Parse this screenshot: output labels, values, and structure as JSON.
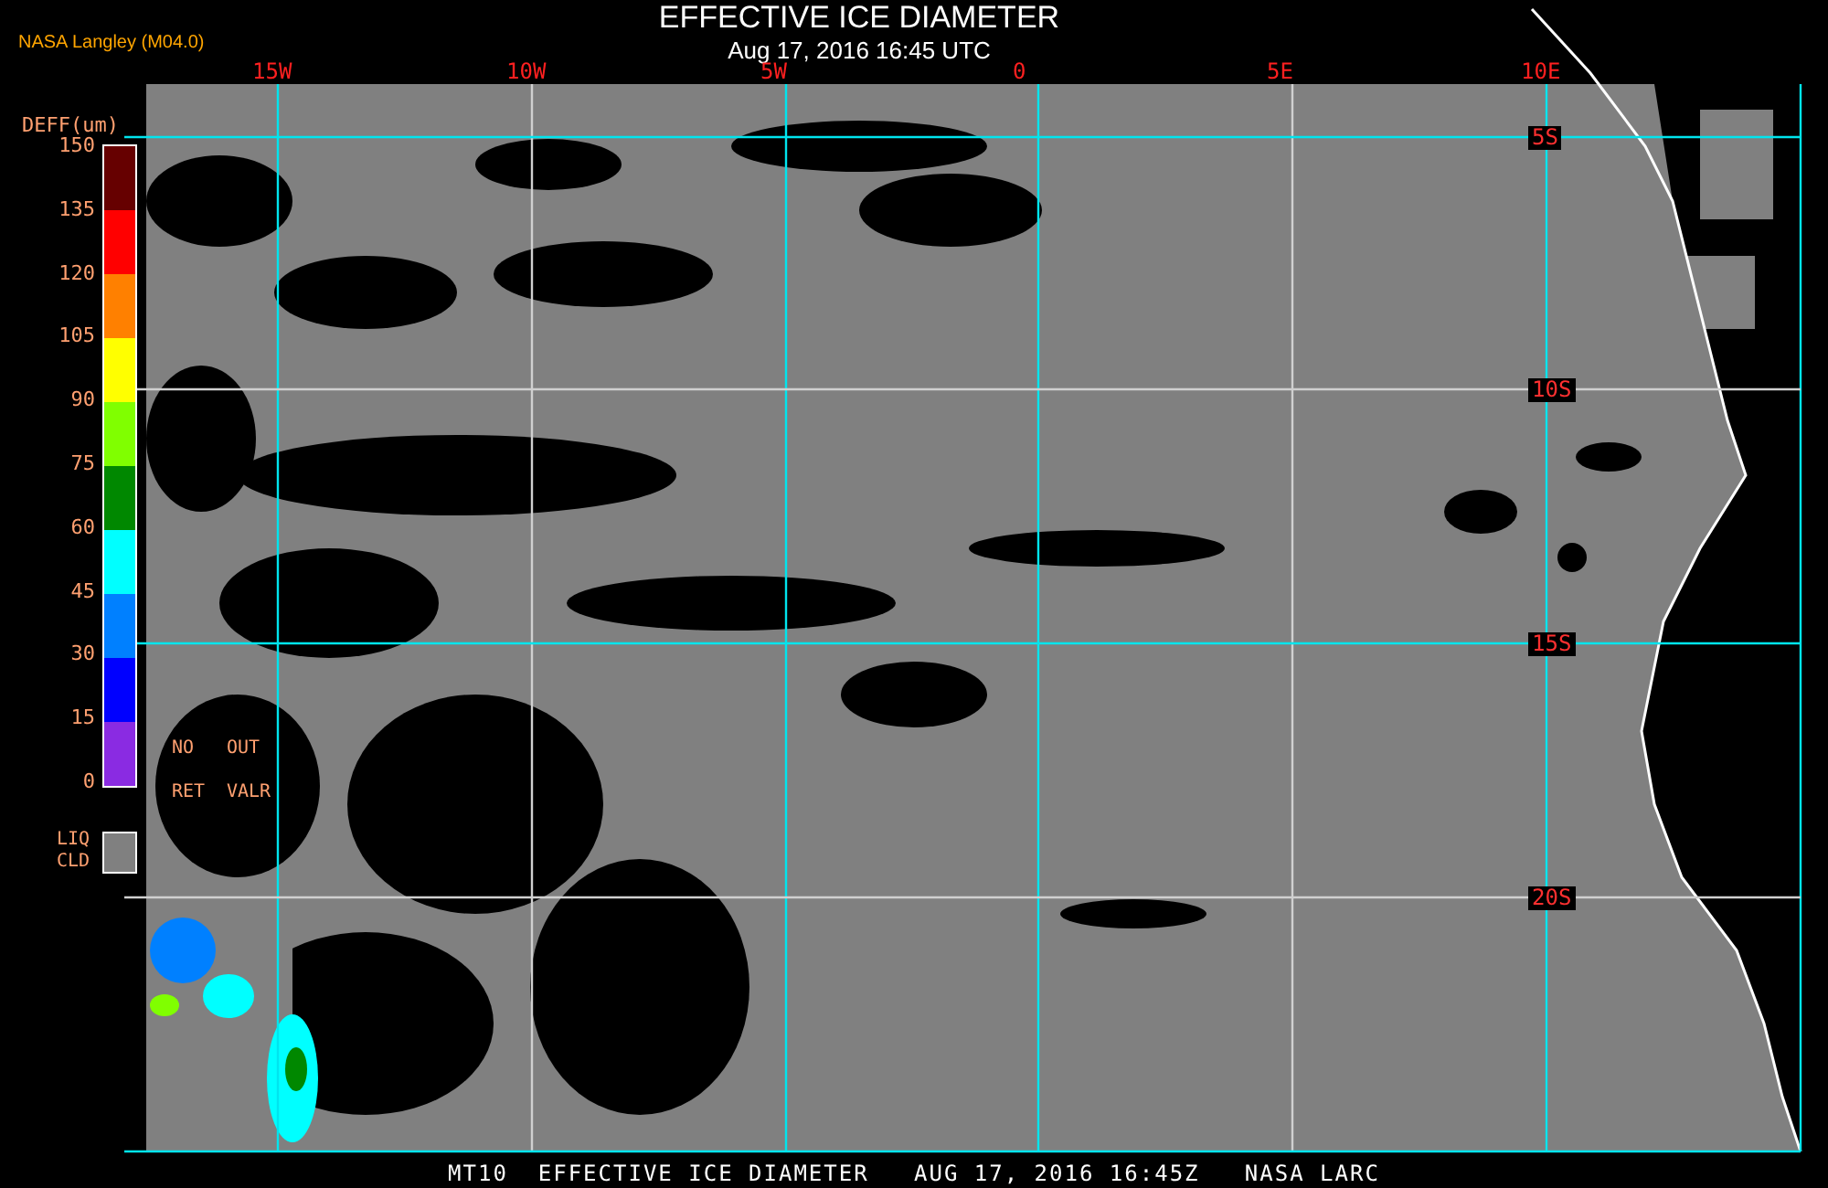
{
  "header": {
    "title": "EFFECTIVE ICE DIAMETER",
    "subtitle": "Aug 17, 2016 16:45 UTC",
    "source": "NASA Langley (M04.0)"
  },
  "map": {
    "longitude_labels": [
      "15W",
      "10W",
      "5W",
      "0",
      "5E",
      "10E"
    ],
    "latitude_labels": [
      "5S",
      "10S",
      "15S",
      "20S"
    ]
  },
  "legend": {
    "title": "DEFF(um)",
    "ticks": [
      "150",
      "135",
      "120",
      "105",
      "90",
      "75",
      "60",
      "45",
      "30",
      "15",
      "0"
    ],
    "segments": [
      {
        "color": "#660000"
      },
      {
        "color": "#ff0000"
      },
      {
        "color": "#ff8000"
      },
      {
        "color": "#ffff00"
      },
      {
        "color": "#80ff00"
      },
      {
        "color": "#008800"
      },
      {
        "color": "#00ffff"
      },
      {
        "color": "#0080ff"
      },
      {
        "color": "#0000ff"
      },
      {
        "color": "#8a2be2"
      }
    ],
    "no_retrieval": [
      "NO",
      "RET"
    ],
    "out_of_range": [
      "OUT",
      "VALR"
    ],
    "liquid_cloud": {
      "label_lines": [
        "LIQ",
        "CLD"
      ],
      "color": "#808080"
    }
  },
  "footer": "MT10  EFFECTIVE ICE DIAMETER   AUG 17, 2016 16:45Z   NASA LARC"
}
